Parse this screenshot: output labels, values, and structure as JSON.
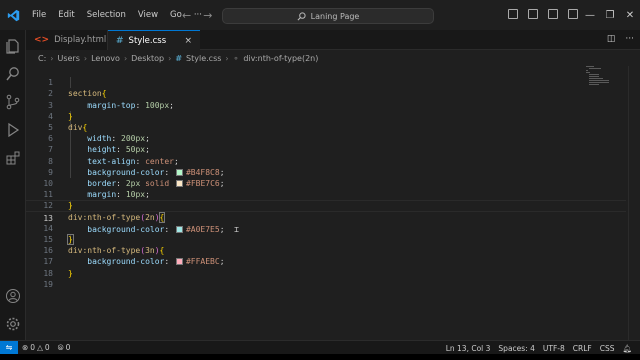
{
  "menu": [
    "File",
    "Edit",
    "Selection",
    "View",
    "Go"
  ],
  "command_center": "Laning Page",
  "tabs": [
    {
      "label": "Display.html",
      "icon": "<>"
    },
    {
      "label": "Style.css",
      "icon": "#",
      "close": "×"
    }
  ],
  "breadcrumb": [
    "C:",
    "Users",
    "Lenovo",
    "Desktop",
    "Style.css",
    "div:nth-of-type(2n)"
  ],
  "editor": {
    "lines": [
      {
        "n": "1",
        "t": "section{"
      },
      {
        "n": "2",
        "t": "margin-top: 100px;"
      },
      {
        "n": "3",
        "t": "}"
      },
      {
        "n": "4",
        "t": "div{"
      },
      {
        "n": "5",
        "t": "width: 200px;"
      },
      {
        "n": "6",
        "t": "height: 50px;"
      },
      {
        "n": "7",
        "t": "text-align: center;"
      },
      {
        "n": "8",
        "t": "background-color: #B4F8C8;"
      },
      {
        "n": "9",
        "t": "border: 2px solid #FBE7C6;"
      },
      {
        "n": "10",
        "t": "margin: 10px;"
      },
      {
        "n": "11",
        "t": "}"
      },
      {
        "n": "12",
        "t": "div:nth-of-type(2n){"
      },
      {
        "n": "13",
        "t": "background-color: #A0E7E5;"
      },
      {
        "n": "14",
        "t": "}"
      },
      {
        "n": "15",
        "t": "div:nth-of-type(3n){"
      },
      {
        "n": "16",
        "t": "background-color: #FFAEBC;"
      },
      {
        "n": "17",
        "t": "}"
      },
      {
        "n": "18",
        "t": ""
      },
      {
        "n": "19",
        "t": ""
      }
    ],
    "current_line": "13",
    "swatches": {
      "b4f8c8": "#B4F8C8",
      "fbe7c6": "#FBE7C6",
      "a0e7e5": "#A0E7E5",
      "ffaebc": "#FFAEBC"
    }
  },
  "status": {
    "errors": "0",
    "warnings": "0",
    "ports": "0",
    "position": "Ln 13, Col 3",
    "spaces": "Spaces: 4",
    "encoding": "UTF-8",
    "eol": "CRLF",
    "language": "CSS"
  },
  "colors": {
    "accent": "#0078d4",
    "background": "#1f1f1f",
    "selector": "#d7ba7d",
    "property": "#9cdcfe",
    "number": "#b5cea8",
    "string": "#ce9178"
  }
}
